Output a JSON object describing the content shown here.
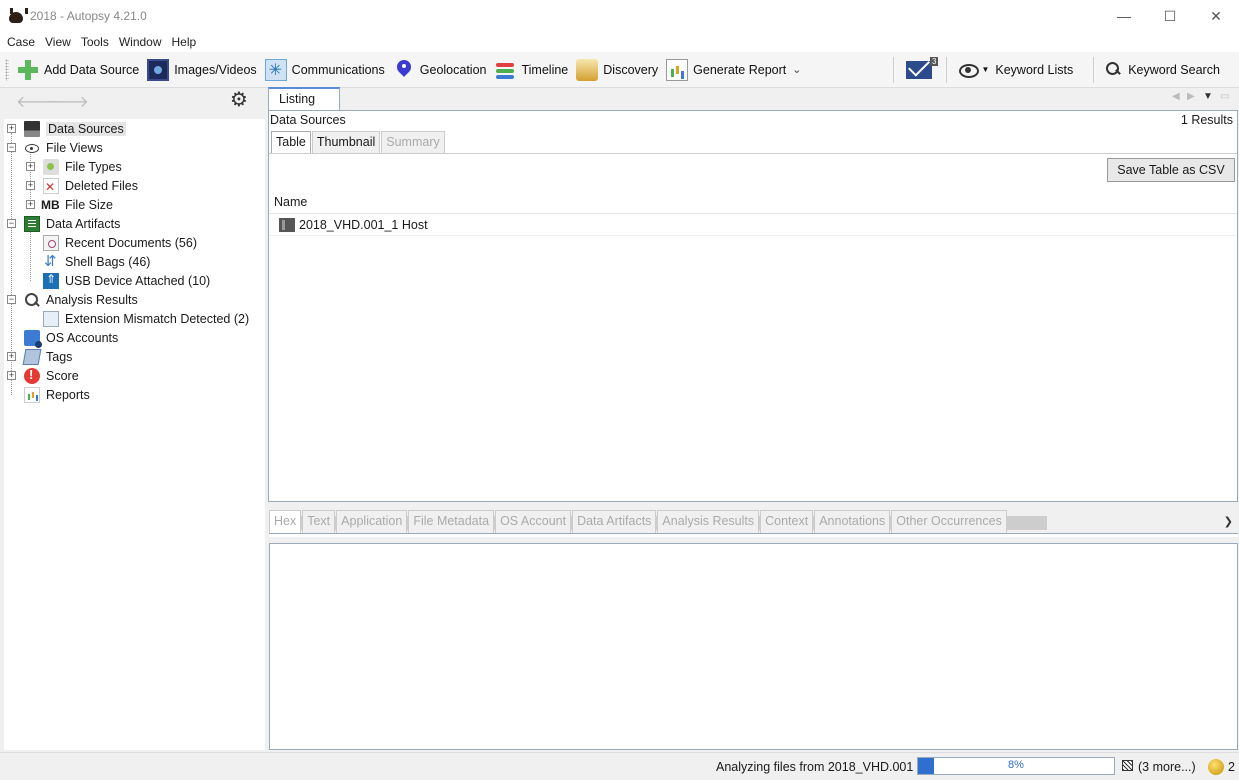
{
  "window": {
    "title": "2018 - Autopsy 4.21.0",
    "minimize": "—",
    "maximize": "☐",
    "close": "✕"
  },
  "menu": [
    "Case",
    "View",
    "Tools",
    "Window",
    "Help"
  ],
  "toolbar": {
    "add_data_source": "Add Data Source",
    "images_videos": "Images/Videos",
    "communications": "Communications",
    "geolocation": "Geolocation",
    "timeline": "Timeline",
    "discovery": "Discovery",
    "generate_report": "Generate Report",
    "mail_badge": "3",
    "keyword_lists": "Keyword Lists",
    "keyword_search": "Keyword Search"
  },
  "tree": {
    "data_sources": "Data Sources",
    "file_views": "File Views",
    "file_types": "File Types",
    "deleted_files": "Deleted Files",
    "mb_label": "MB",
    "file_size": "File Size",
    "data_artifacts": "Data Artifacts",
    "recent_documents": "Recent Documents (56)",
    "shell_bags": "Shell Bags (46)",
    "usb_device": "USB Device Attached (10)",
    "analysis_results": "Analysis Results",
    "extension_mismatch": "Extension Mismatch Detected (2)",
    "os_accounts": "OS Accounts",
    "tags": "Tags",
    "score": "Score",
    "reports": "Reports"
  },
  "listing": {
    "tab_label": "Listing",
    "section_label": "Data Sources",
    "results_count": "1  Results",
    "subtabs": [
      "Table",
      "Thumbnail",
      "Summary"
    ],
    "save_csv": "Save Table as CSV",
    "column_name": "Name",
    "rows": [
      {
        "name": "2018_VHD.001_1 Host"
      }
    ]
  },
  "content_tabs": [
    "Hex",
    "Text",
    "Application",
    "File Metadata",
    "OS Account",
    "Data Artifacts",
    "Analysis Results",
    "Context",
    "Annotations",
    "Other Occurrences"
  ],
  "status": {
    "message": "Analyzing files from 2018_VHD.001",
    "progress": 8,
    "progress_text": "8%",
    "more_tasks": "(3 more...)",
    "notifications": "2"
  },
  "colors": {
    "accent": "#2f6fcf",
    "panel_border": "#99aabb",
    "score_red": "#e53935"
  }
}
